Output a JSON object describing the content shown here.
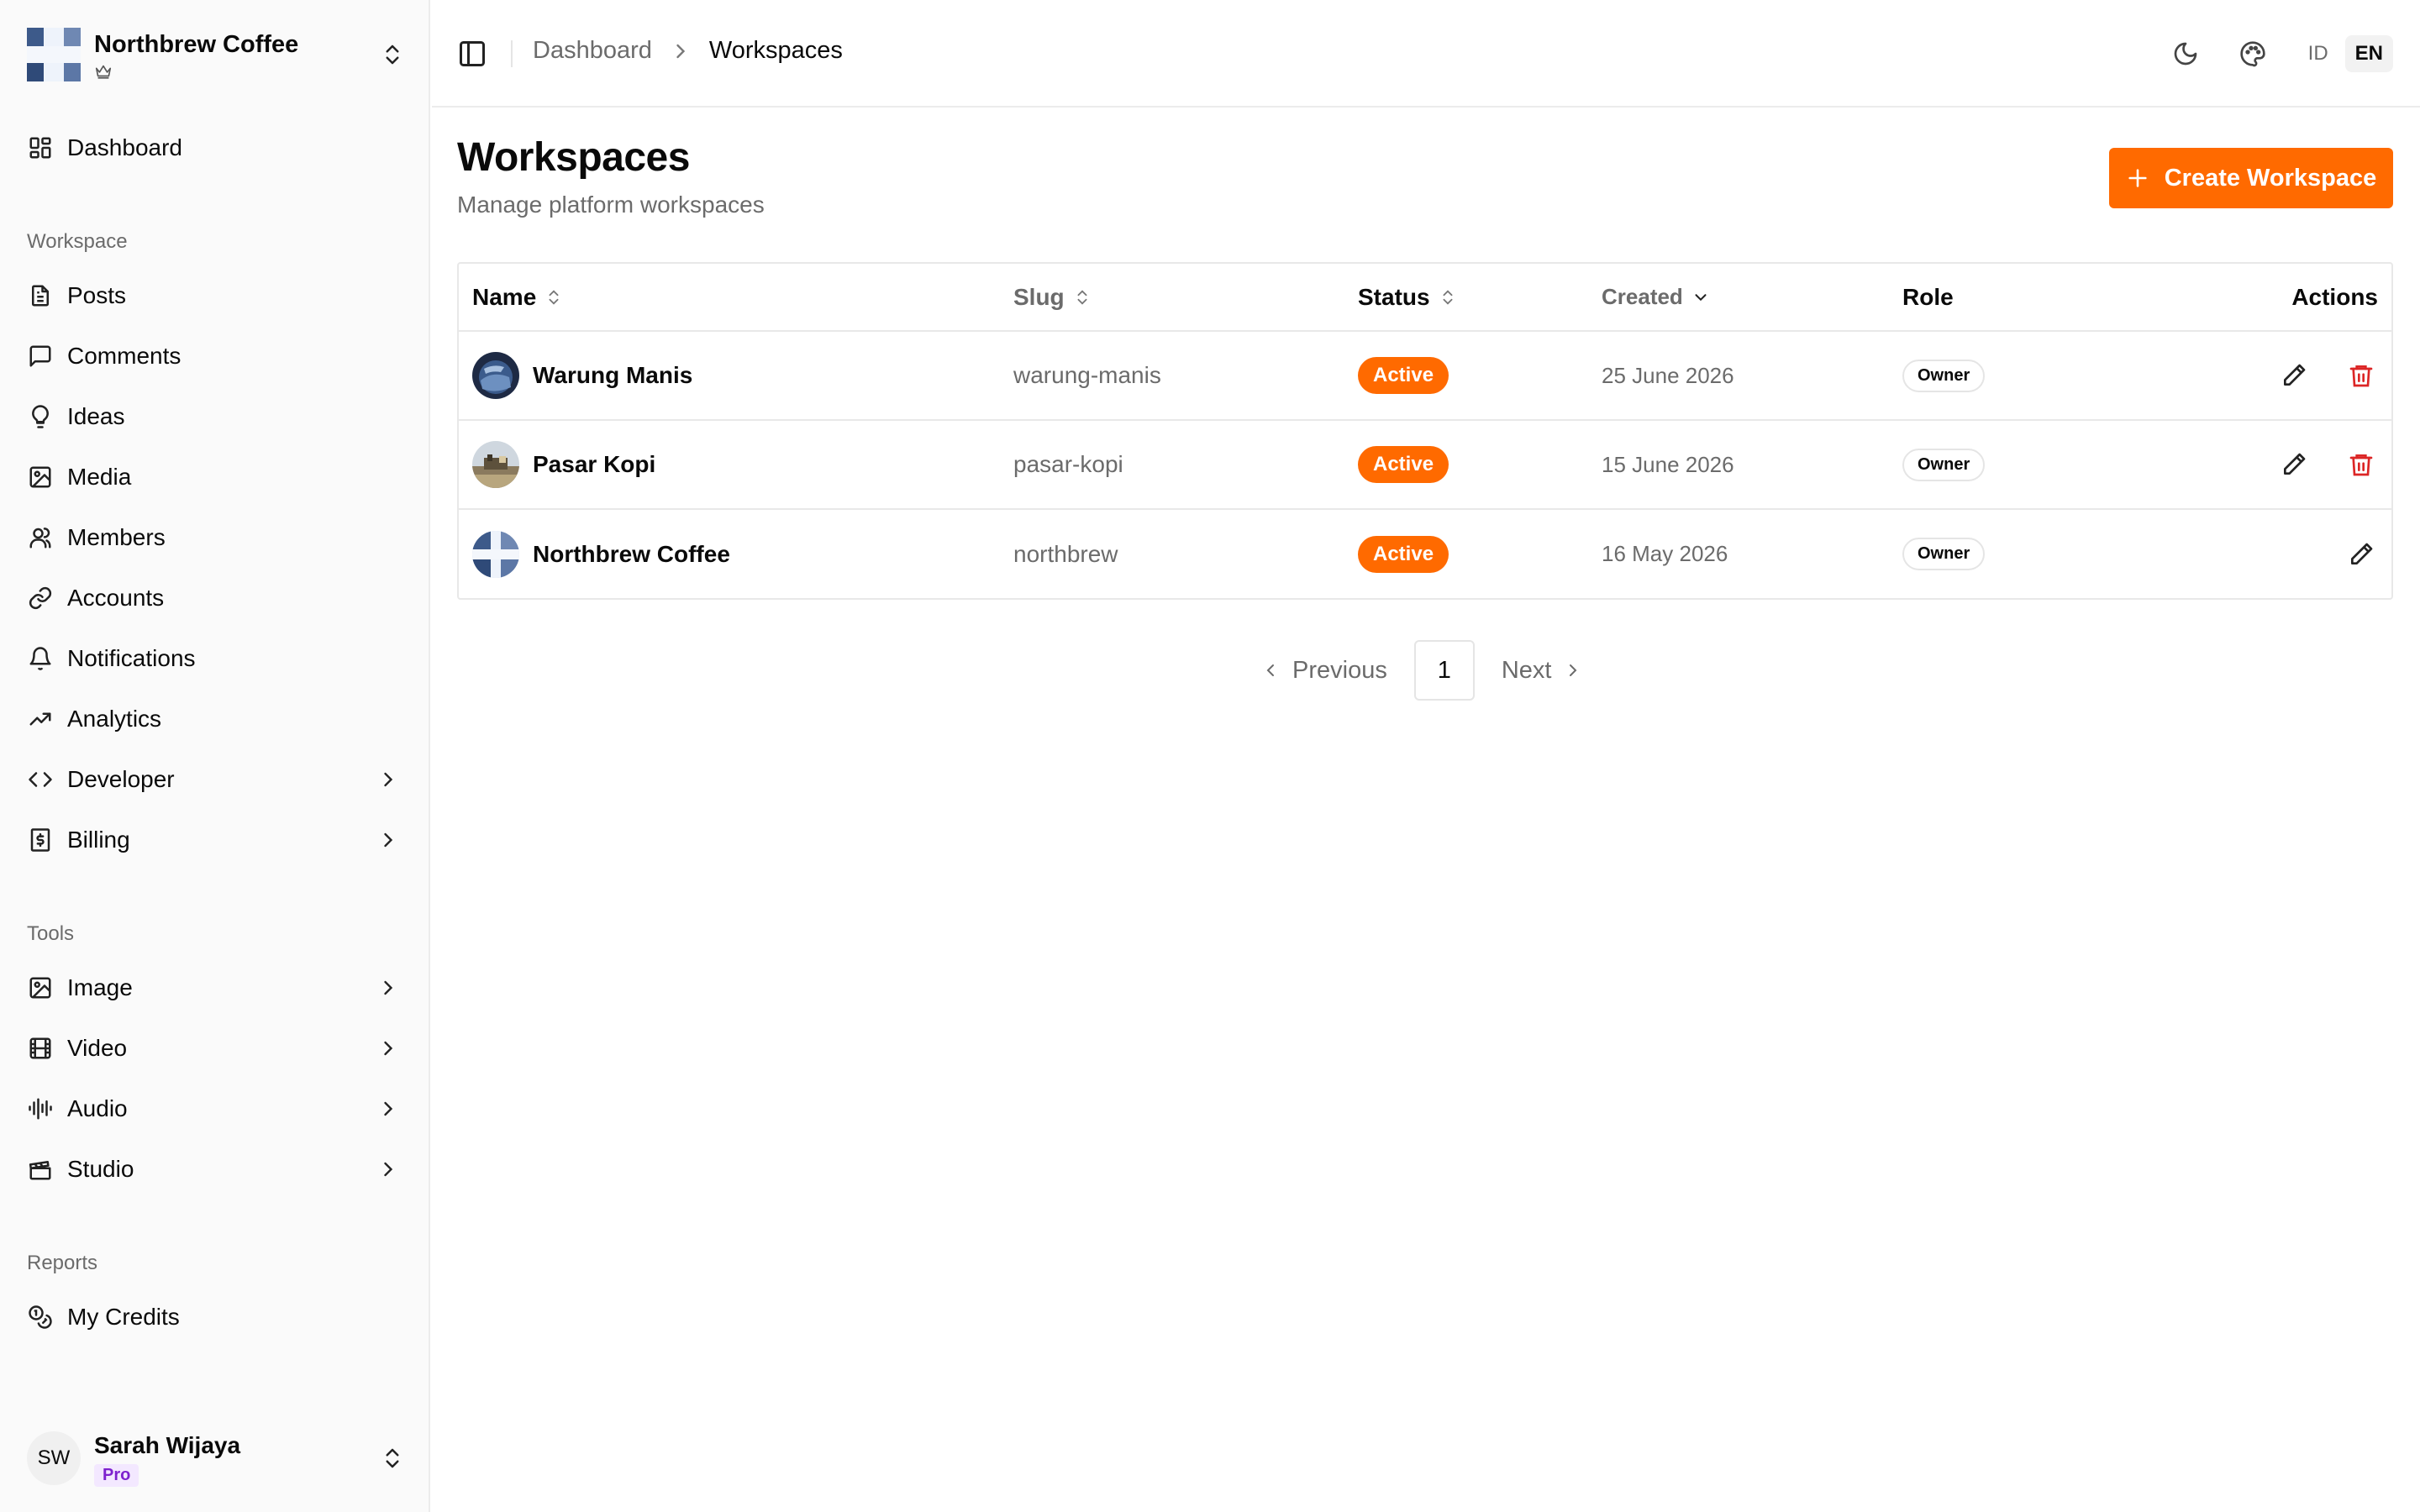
{
  "workspace_switcher": {
    "name": "Northbrew Coffee"
  },
  "sidebar": {
    "dashboard": {
      "label": "Dashboard"
    },
    "groups": {
      "workspace": "Workspace",
      "tools": "Tools",
      "reports": "Reports"
    },
    "workspace_items": [
      {
        "label": "Posts",
        "icon": "document-icon"
      },
      {
        "label": "Comments",
        "icon": "message-square-icon"
      },
      {
        "label": "Ideas",
        "icon": "lightbulb-icon"
      },
      {
        "label": "Media",
        "icon": "image-icon"
      },
      {
        "label": "Members",
        "icon": "users-icon"
      },
      {
        "label": "Accounts",
        "icon": "link-icon"
      },
      {
        "label": "Notifications",
        "icon": "bell-icon"
      },
      {
        "label": "Analytics",
        "icon": "trending-up-icon"
      },
      {
        "label": "Developer",
        "icon": "code-icon"
      },
      {
        "label": "Billing",
        "icon": "receipt-dollar-icon"
      }
    ],
    "tools_items": [
      {
        "label": "Image",
        "icon": "image-icon"
      },
      {
        "label": "Video",
        "icon": "film-icon"
      },
      {
        "label": "Audio",
        "icon": "audio-lines-icon"
      },
      {
        "label": "Studio",
        "icon": "clapperboard-icon"
      }
    ],
    "reports_items": [
      {
        "label": "My Credits",
        "icon": "coins-icon"
      }
    ]
  },
  "user": {
    "initials": "SW",
    "name": "Sarah Wijaya",
    "plan": "Pro"
  },
  "header": {
    "breadcrumb": {
      "parent": "Dashboard",
      "current": "Workspaces"
    },
    "lang": {
      "id": "ID",
      "en": "EN",
      "active": "EN"
    }
  },
  "page": {
    "title": "Workspaces",
    "subtitle": "Manage platform workspaces",
    "create_button": "Create Workspace"
  },
  "table": {
    "columns": {
      "name": "Name",
      "slug": "Slug",
      "status": "Status",
      "created": "Created",
      "role": "Role",
      "actions": "Actions"
    },
    "rows": [
      {
        "name": "Warung Manis",
        "slug": "warung-manis",
        "status": "Active",
        "created": "25 June 2026",
        "role": "Owner"
      },
      {
        "name": "Pasar Kopi",
        "slug": "pasar-kopi",
        "status": "Active",
        "created": "15 June 2026",
        "role": "Owner"
      },
      {
        "name": "Northbrew Coffee",
        "slug": "northbrew",
        "status": "Active",
        "created": "16 May 2026",
        "role": "Owner"
      }
    ]
  },
  "pagination": {
    "previous": "Previous",
    "page": "1",
    "next": "Next"
  },
  "colors": {
    "accent": "#ff6a00",
    "danger": "#dc2626",
    "muted": "#6b6b6b"
  }
}
